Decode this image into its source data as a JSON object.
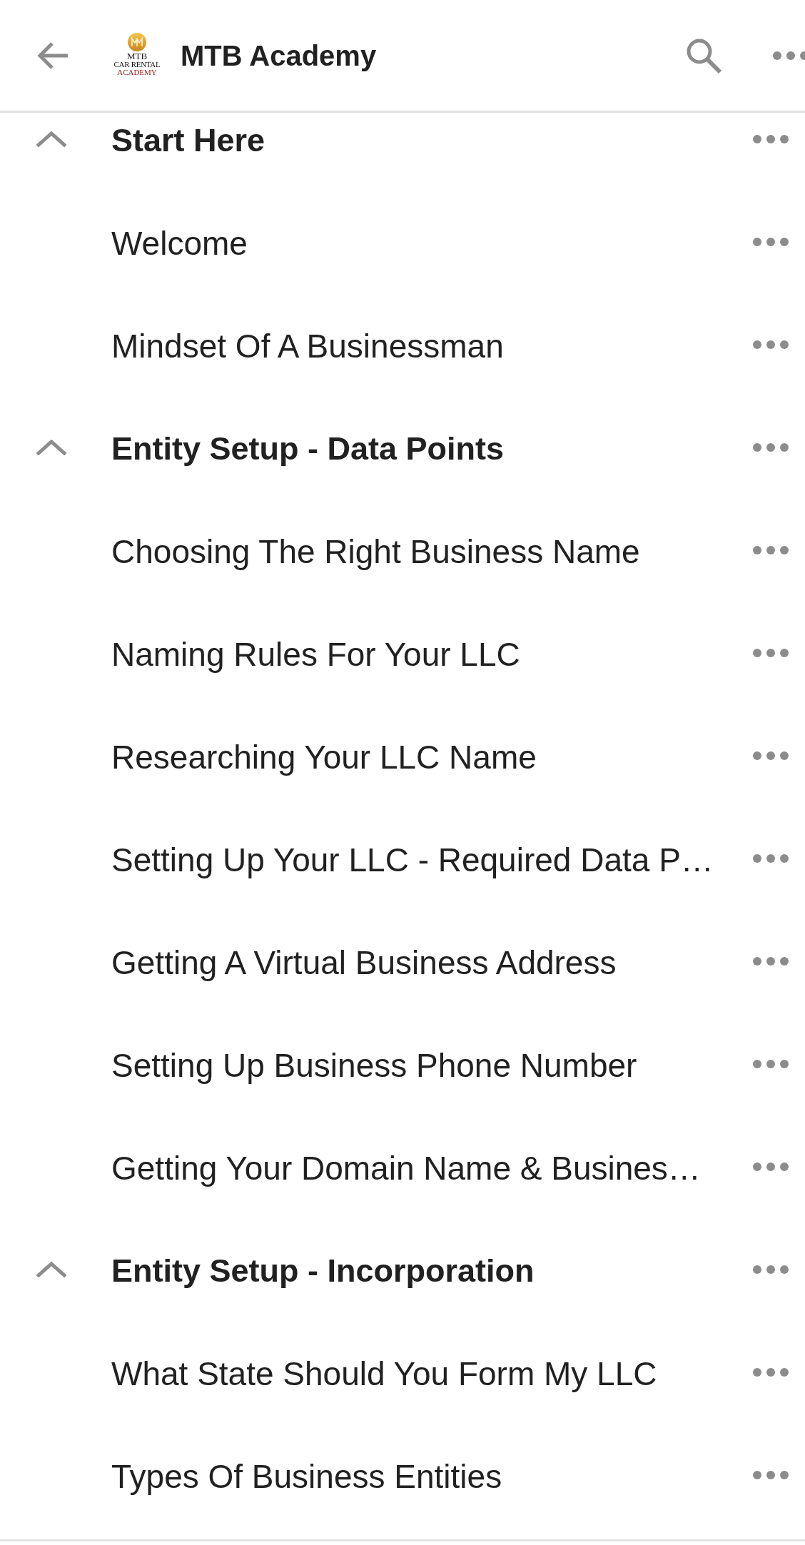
{
  "header": {
    "title": "MTB Academy",
    "logo": {
      "lines": [
        "MTB",
        "CAR RENTAL",
        "ACADEMY"
      ]
    }
  },
  "sections": [
    {
      "title": "Start Here",
      "expanded": true,
      "children": [
        {
          "title": "Welcome"
        },
        {
          "title": "Mindset Of A Businessman"
        }
      ]
    },
    {
      "title": "Entity Setup - Data Points",
      "expanded": true,
      "children": [
        {
          "title": "Choosing The Right Business Name"
        },
        {
          "title": "Naming Rules For Your LLC"
        },
        {
          "title": "Researching Your LLC Name"
        },
        {
          "title": "Setting Up Your LLC - Required Data P…"
        },
        {
          "title": "Getting A Virtual Business Address"
        },
        {
          "title": "Setting Up Business Phone Number"
        },
        {
          "title": "Getting Your Domain Name & Busines…"
        }
      ]
    },
    {
      "title": "Entity Setup - Incorporation",
      "expanded": true,
      "children": [
        {
          "title": "What State Should You Form My LLC"
        },
        {
          "title": "Types Of Business Entities"
        }
      ]
    }
  ]
}
